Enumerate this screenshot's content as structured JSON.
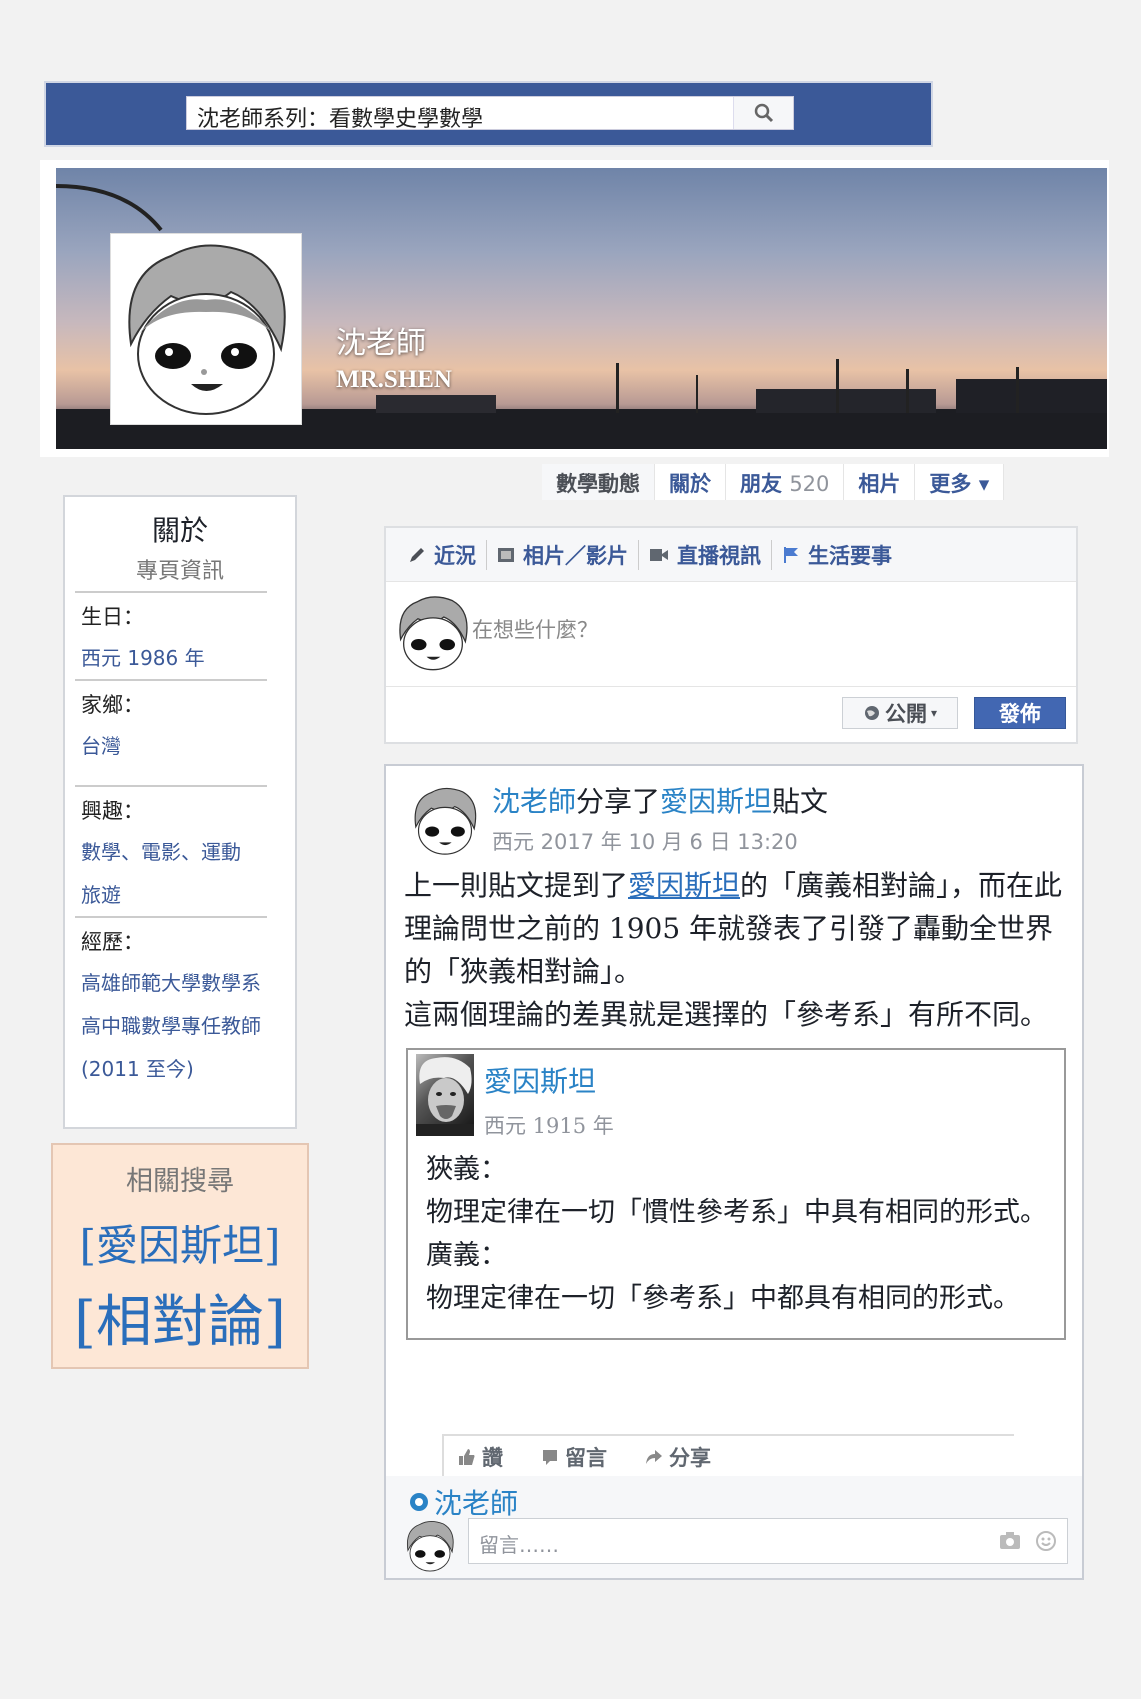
{
  "search": {
    "query": "沈老師系列：看數學史學數學"
  },
  "profile": {
    "name": "沈老師",
    "subtitle": "MR.SHEN"
  },
  "nav": {
    "tabs": [
      {
        "label": "數學動態"
      },
      {
        "label": "關於"
      },
      {
        "label": "朋友",
        "count": "520"
      },
      {
        "label": "相片"
      },
      {
        "label": "更多 ▾"
      }
    ]
  },
  "about": {
    "title": "關於",
    "subtitle": "專頁資訊",
    "birthday_label": "生日：",
    "birthday_value": "西元 1986 年",
    "hometown_label": "家鄉：",
    "hometown_value": "台灣",
    "interests_label": "興趣：",
    "interests_value_1": "數學、電影、運動",
    "interests_value_2": "旅遊",
    "experience_label": "經歷：",
    "experience_value_1": "高雄師範大學數學系",
    "experience_value_2": "高中職數學專任教師",
    "experience_value_3": "(2011 至今)"
  },
  "related": {
    "title": "相關搜尋",
    "links": [
      "[愛因斯坦]",
      "[相對論]"
    ]
  },
  "composer": {
    "tabs": [
      "近況",
      "相片／影片",
      "直播視訊",
      "生活要事"
    ],
    "placeholder": "在想些什麼？",
    "privacy": "公開",
    "post_button": "發佈"
  },
  "post": {
    "author": "沈老師",
    "shared_text": "分享了",
    "shared_from": "愛因斯坦",
    "post_word": "貼文",
    "date": "西元 2017 年 10 月 6 日  13:20",
    "body_1": "上一則貼文提到了",
    "body_link": "愛因斯坦",
    "body_2": "的「廣義相對論」，而在此理論問世之前的 1905 年就發表了引發了轟動全世界的「狹義相對論」。",
    "body_3": "這兩個理論的差異就是選擇的「參考系」有所不同。",
    "quote": {
      "name": "愛因斯坦",
      "date": "西元 1915 年",
      "line_1": "狹義：",
      "line_2": "物理定律在一切「慣性參考系」中具有相同的形式。",
      "line_3": "廣義：",
      "line_4": "物理定律在一切「參考系」中都具有相同的形式。"
    },
    "actions": [
      "讚",
      "留言",
      "分享"
    ],
    "commenter": "沈老師",
    "comment_placeholder": "留言……"
  },
  "colors": {
    "facebook_blue": "#3b5998",
    "link_blue": "#2a83c6",
    "related_bg": "#fde7d6"
  },
  "icons": [
    "search-icon",
    "pencil-icon",
    "photo-icon",
    "video-icon",
    "flag-icon",
    "globe-icon",
    "like-icon",
    "comment-icon",
    "share-icon",
    "camera-icon",
    "emoji-icon"
  ]
}
